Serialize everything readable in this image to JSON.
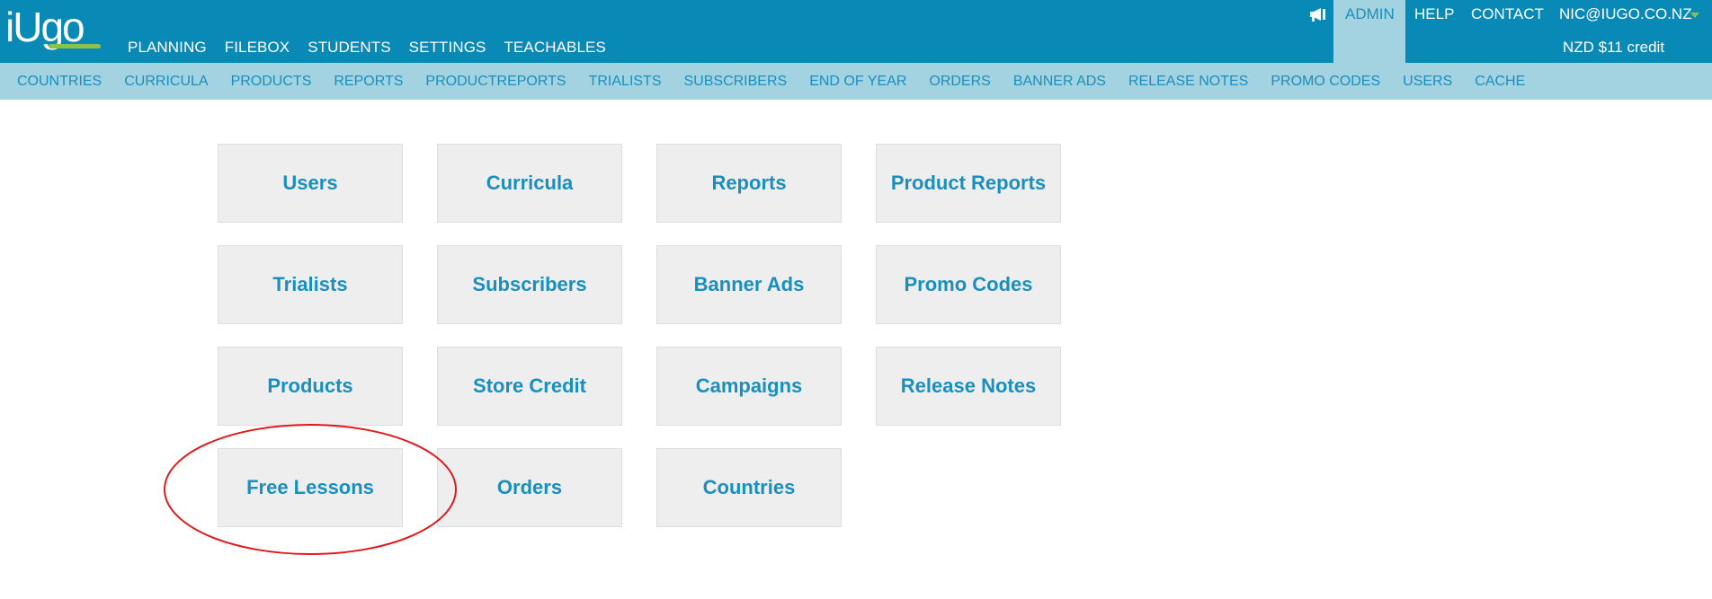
{
  "brand": {
    "logo_text": "iUgo",
    "logo_color": "#ffffff",
    "logo_accent": "#8bc34a"
  },
  "colors": {
    "topbar": "#0989b6",
    "subnav": "#a3d2e1",
    "link": "#1a8fbd",
    "tile_bg": "#eeeeee",
    "annotation": "#e0191b"
  },
  "main_nav": [
    {
      "label": "PLANNING"
    },
    {
      "label": "FILEBOX"
    },
    {
      "label": "STUDENTS"
    },
    {
      "label": "SETTINGS"
    },
    {
      "label": "TEACHABLES"
    }
  ],
  "top_right": {
    "announce_icon": "megaphone-icon",
    "admin_label": "ADMIN",
    "help_label": "HELP",
    "contact_label": "CONTACT",
    "account_label": "NIC@IUGO.CO.NZ",
    "credit_label": "NZD $11 credit"
  },
  "sub_nav": [
    {
      "label": "COUNTRIES"
    },
    {
      "label": "CURRICULA"
    },
    {
      "label": "PRODUCTS"
    },
    {
      "label": "REPORTS"
    },
    {
      "label": "PRODUCTREPORTS"
    },
    {
      "label": "TRIALISTS"
    },
    {
      "label": "SUBSCRIBERS"
    },
    {
      "label": "END OF YEAR"
    },
    {
      "label": "ORDERS"
    },
    {
      "label": "BANNER ADS"
    },
    {
      "label": "RELEASE NOTES"
    },
    {
      "label": "PROMO CODES"
    },
    {
      "label": "USERS"
    },
    {
      "label": "CACHE"
    }
  ],
  "tiles": [
    {
      "label": "Users"
    },
    {
      "label": "Curricula"
    },
    {
      "label": "Reports"
    },
    {
      "label": "Product Reports"
    },
    {
      "label": "Trialists"
    },
    {
      "label": "Subscribers"
    },
    {
      "label": "Banner Ads"
    },
    {
      "label": "Promo Codes"
    },
    {
      "label": "Products"
    },
    {
      "label": "Store Credit"
    },
    {
      "label": "Campaigns"
    },
    {
      "label": "Release Notes"
    },
    {
      "label": "Free Lessons"
    },
    {
      "label": "Orders"
    },
    {
      "label": "Countries"
    }
  ]
}
